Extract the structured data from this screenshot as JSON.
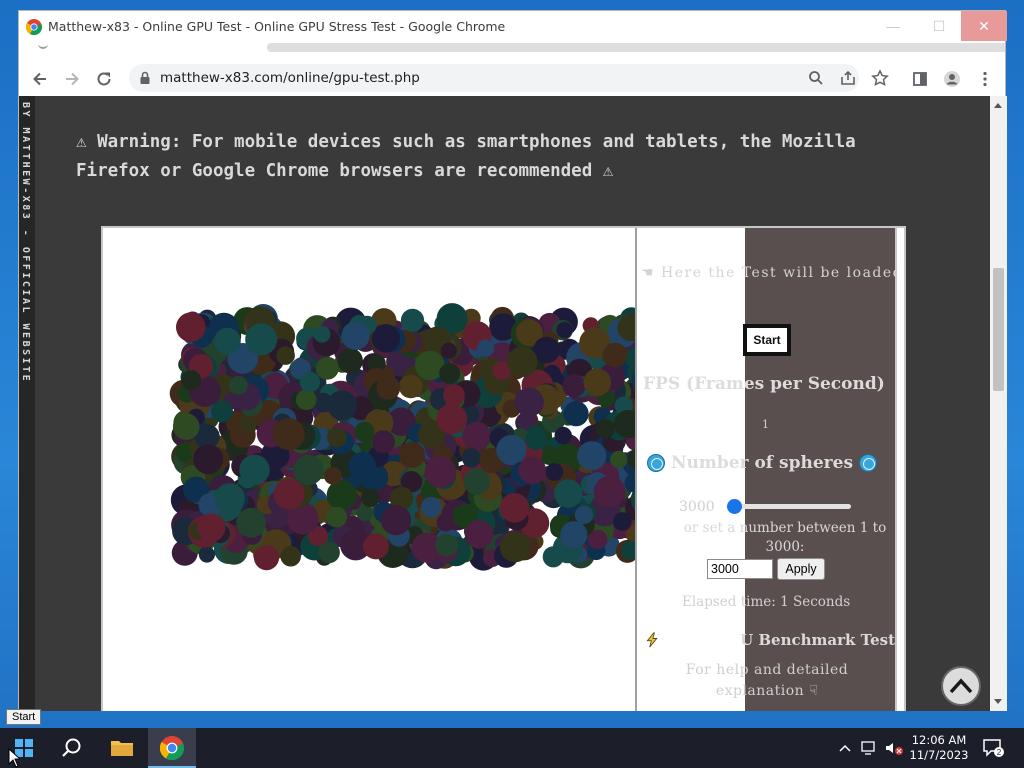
{
  "window": {
    "title": "Matthew-x83 - Online GPU Test - Online GPU Stress Test - Google Chrome",
    "controls": {
      "minimize": "—",
      "maximize": "☐",
      "close": "✕"
    }
  },
  "toolbar": {
    "url": "matthew-x83.com/online/gpu-test.php"
  },
  "page": {
    "side_ribbon": "BY MATTHEW-X83 - OFFICIAL WEBSITE",
    "warning": "⚠ Warning: For mobile devices such as smartphones and tablets, the Mozilla Firefox or Google Chrome browsers are recommended ⚠",
    "panel": {
      "loaded_text": "☚ Here the Test will be loaded",
      "start_label": "Start",
      "fps_title": "FPS (Frames per Second)",
      "fps_value": "1",
      "spheres_title": "Number of spheres",
      "slider_value": "3000",
      "slider_level": 0.0,
      "or_text": "or set a number between 1 to 3000:",
      "input_value": "3000",
      "apply_label": "Apply",
      "elapsed": "Elapsed time: 1 Seconds",
      "bench_title": "U Benchmark Test",
      "help_text": "For help and detailed explanation ☟"
    }
  },
  "tooltip": "Start",
  "taskbar": {
    "time": "12:06 AM",
    "date": "11/7/2023",
    "notification_count": "2"
  },
  "colors": {
    "page_bg": "#3a3a3a",
    "panel_dark": "#5a4f4f",
    "accent": "#1a73e8",
    "taskbar": "#1c1f2a"
  }
}
